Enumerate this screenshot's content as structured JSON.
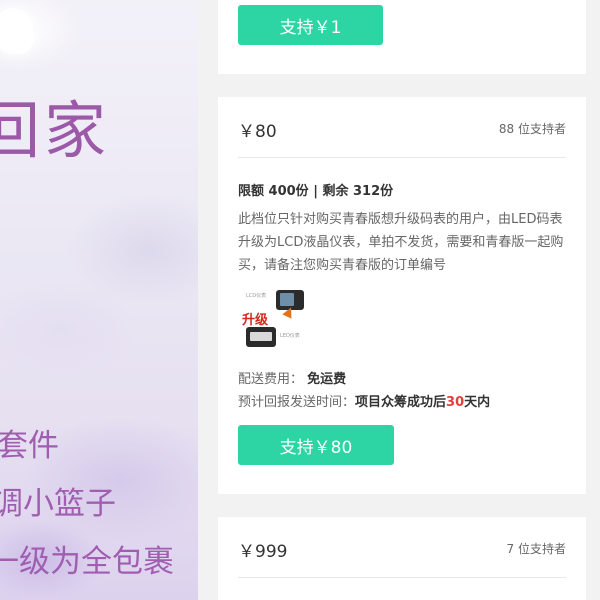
{
  "banner": {
    "title_fragment": "回家",
    "lines": [
      "套件",
      "调小篮子",
      "一级为全包裹"
    ]
  },
  "reward_top": {
    "button_label": "支持￥1"
  },
  "reward_80": {
    "price": "￥80",
    "backers": "88 位支持者",
    "limit": "限额 400份 | 剩余 312份",
    "description": "此档位只针对购买青春版想升级码表的用户，由LED码表升级为LCD液晶仪表，单拍不发货，需要和青春版一起购买，请备注您购买青春版的订单编号",
    "image": {
      "label_top": "LCD仪表",
      "upgrade_text": "升级",
      "label_bottom": "LED仪表"
    },
    "shipping_label": "配送费用：",
    "shipping_value": "免运费",
    "eta_label": "预计回报发送时间：",
    "eta_prefix": "项目众筹成功后",
    "eta_days": "30",
    "eta_suffix": "天内",
    "button_label": "支持￥80"
  },
  "reward_999": {
    "price": "￥999",
    "backers": "7 位支持者"
  },
  "colors": {
    "accent": "#2dd5a4",
    "highlight_red": "#e93b3b",
    "banner_purple": "#9b59a8"
  }
}
